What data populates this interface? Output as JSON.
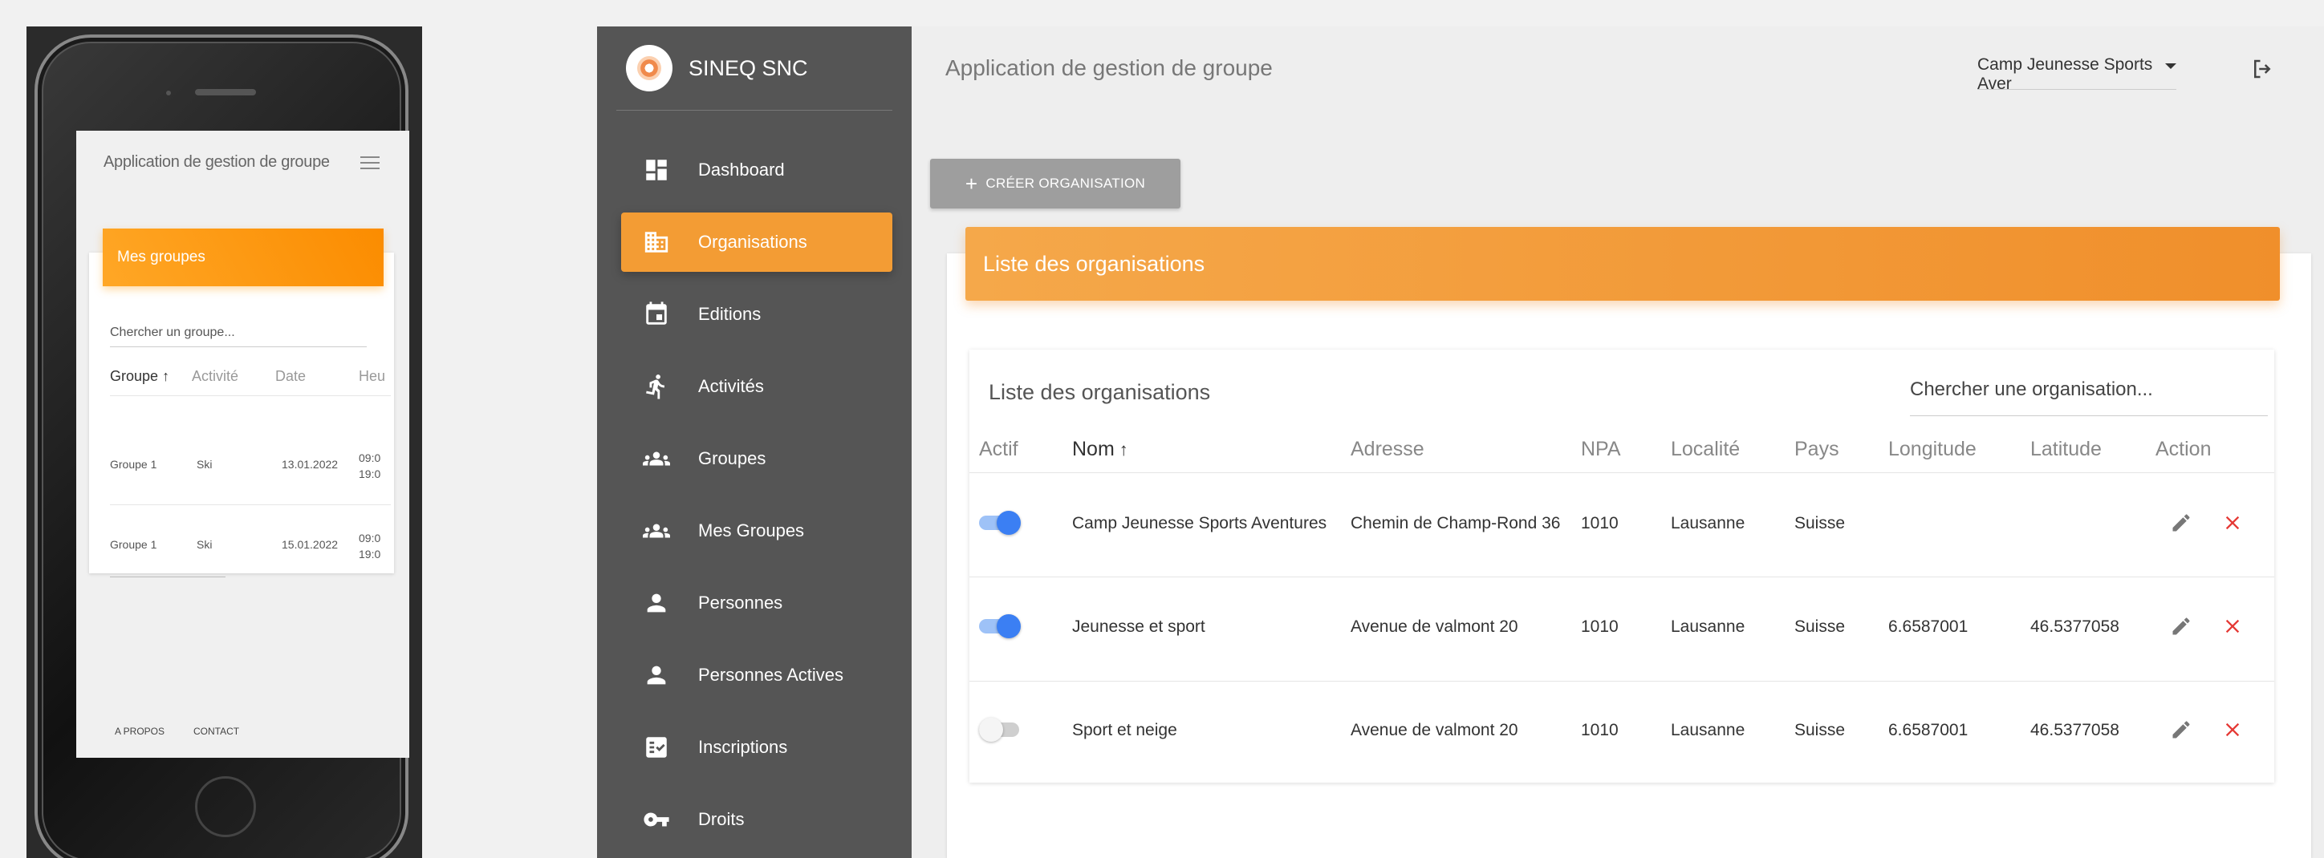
{
  "mobile": {
    "app_title": "Application de gestion de groupe",
    "card_title": "Mes groupes",
    "search_placeholder": "Chercher un groupe...",
    "columns": [
      "Groupe",
      "Activité",
      "Date",
      "Heu"
    ],
    "rows": [
      {
        "groupe": "Groupe 1",
        "activite": "Ski",
        "date": "13.01.2022",
        "heure": "09:0\n19:0"
      },
      {
        "groupe": "Groupe 1",
        "activite": "Ski",
        "date": "15.01.2022",
        "heure": "09:0\n19:0"
      }
    ],
    "footer": {
      "about": "A propos",
      "contact": "Contact"
    }
  },
  "sidebar": {
    "brand": "SINEQ SNC",
    "items": [
      {
        "label": "Dashboard",
        "icon": "dashboard-icon"
      },
      {
        "label": "Organisations",
        "icon": "business-icon",
        "active": true
      },
      {
        "label": "Editions",
        "icon": "calendar-icon"
      },
      {
        "label": "Activités",
        "icon": "run-icon"
      },
      {
        "label": "Groupes",
        "icon": "group-icon"
      },
      {
        "label": "Mes Groupes",
        "icon": "group-icon"
      },
      {
        "label": "Personnes",
        "icon": "person-icon"
      },
      {
        "label": "Personnes Actives",
        "icon": "person-icon"
      },
      {
        "label": "Inscriptions",
        "icon": "checklist-icon"
      },
      {
        "label": "Droits",
        "icon": "key-icon"
      }
    ]
  },
  "header": {
    "title": "Application de gestion de groupe",
    "org_selector": "Camp Jeunesse Sports Aver"
  },
  "toolbar": {
    "create_label": "CRÉER ORGANISATION"
  },
  "panel": {
    "header_title": "Liste des organisations",
    "table_title": "Liste des organisations",
    "search_placeholder": "Chercher une organisation..."
  },
  "table": {
    "columns": [
      "Actif",
      "Nom",
      "Adresse",
      "NPA",
      "Localité",
      "Pays",
      "Longitude",
      "Latitude",
      "Action"
    ],
    "rows": [
      {
        "actif": true,
        "nom": "Camp Jeunesse Sports Aventures",
        "adresse": "Chemin de Champ-Rond 36",
        "npa": "1010",
        "localite": "Lausanne",
        "pays": "Suisse",
        "longitude": "",
        "latitude": ""
      },
      {
        "actif": true,
        "nom": "Jeunesse et sport",
        "adresse": "Avenue de valmont 20",
        "npa": "1010",
        "localite": "Lausanne",
        "pays": "Suisse",
        "longitude": "6.6587001",
        "latitude": "46.5377058"
      },
      {
        "actif": false,
        "nom": "Sport et neige",
        "adresse": "Avenue de valmont 20",
        "npa": "1010",
        "localite": "Lausanne",
        "pays": "Suisse",
        "longitude": "6.6587001",
        "latitude": "46.5377058"
      }
    ]
  },
  "colors": {
    "accent": "#f39c34",
    "sidebar": "#555555",
    "toggle_on": "#3b7ff3",
    "delete": "#e53935"
  }
}
